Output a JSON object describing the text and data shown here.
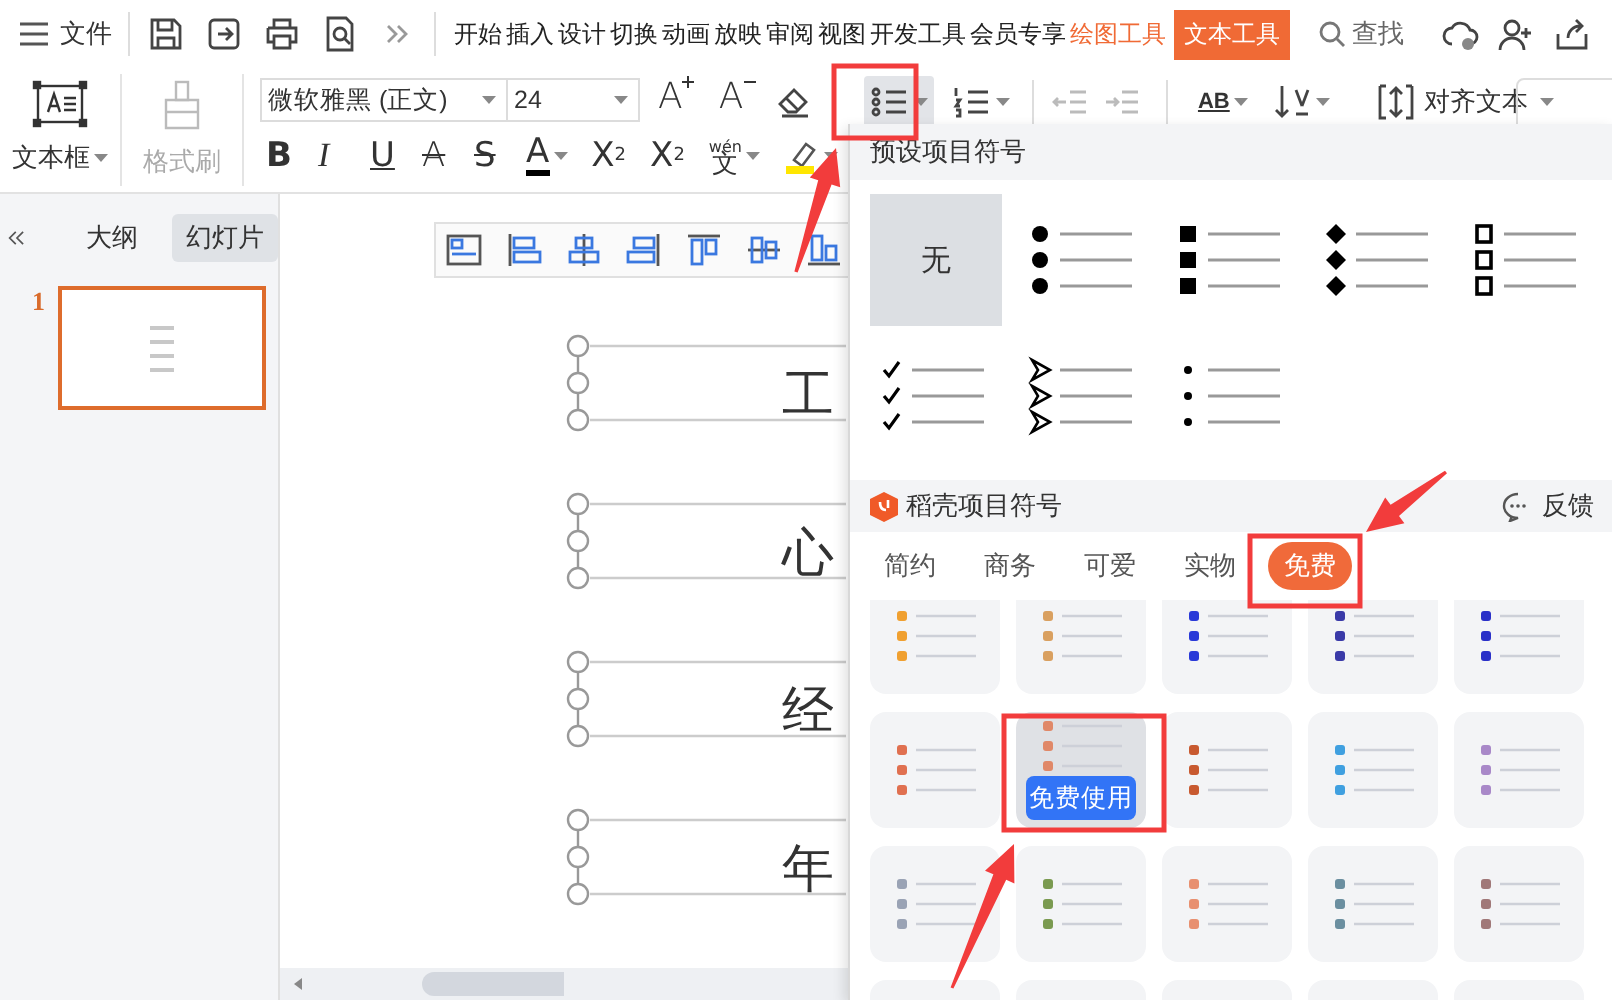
{
  "top_bar": {
    "file_menu": "文件",
    "tabs": [
      {
        "label": "开始",
        "kind": "normal",
        "selected": false
      },
      {
        "label": "插入",
        "kind": "normal",
        "selected": false
      },
      {
        "label": "设计",
        "kind": "normal",
        "selected": false
      },
      {
        "label": "切换",
        "kind": "normal",
        "selected": false
      },
      {
        "label": "动画",
        "kind": "normal",
        "selected": false
      },
      {
        "label": "放映",
        "kind": "normal",
        "selected": false
      },
      {
        "label": "审阅",
        "kind": "normal",
        "selected": false
      },
      {
        "label": "视图",
        "kind": "normal",
        "selected": false
      },
      {
        "label": "开发工具",
        "kind": "normal",
        "selected": false
      },
      {
        "label": "会员专享",
        "kind": "normal",
        "selected": false
      },
      {
        "label": "绘图工具",
        "kind": "context",
        "selected": false
      },
      {
        "label": "文本工具",
        "kind": "context",
        "selected": true
      }
    ],
    "search": "查找"
  },
  "ribbon": {
    "text_box": "文本框",
    "format_painter": {
      "label": "格式刷",
      "disabled": true
    },
    "font_name": "微软雅黑 (正文)",
    "font_size": "24",
    "font_tools": [
      {
        "kind": "grow",
        "label": "A"
      },
      {
        "kind": "shrink",
        "label": "A"
      }
    ],
    "format_buttons": [
      {
        "kind": "bold",
        "label": "B"
      },
      {
        "kind": "italic",
        "label": "I"
      },
      {
        "kind": "underline",
        "label": "U"
      },
      {
        "kind": "strike_a",
        "label": "A"
      },
      {
        "kind": "strike",
        "label": "S"
      },
      {
        "kind": "color",
        "label": "A"
      },
      {
        "kind": "superscript",
        "label": "X",
        "script": "2"
      },
      {
        "kind": "subscript",
        "label": "X",
        "script": "2"
      },
      {
        "kind": "phonetic",
        "label": "文",
        "script": "wén"
      }
    ],
    "bullets": {
      "selected": true
    },
    "text_direction": "AB",
    "align_text": "对齐文本"
  },
  "side_panel": {
    "tabs": [
      {
        "label": "大纲",
        "selected": false
      },
      {
        "label": "幻灯片",
        "selected": true
      }
    ],
    "slides": [
      {
        "number": "1",
        "selected": true
      }
    ]
  },
  "slide": {
    "items": [
      {
        "text": "工"
      },
      {
        "text": "心"
      },
      {
        "text": "经"
      },
      {
        "text": "年"
      }
    ]
  },
  "bullet_menu": {
    "preset_title": "预设项目符号",
    "presets": [
      {
        "kind": "none",
        "label": "无",
        "selected": true
      },
      {
        "kind": "dot",
        "selected": false
      },
      {
        "kind": "square",
        "selected": false
      },
      {
        "kind": "diamond",
        "selected": false
      },
      {
        "kind": "box",
        "selected": false
      },
      {
        "kind": "check",
        "selected": false
      },
      {
        "kind": "arrow",
        "selected": false
      },
      {
        "kind": "small_dot",
        "selected": false
      }
    ],
    "docer_title": "稻壳项目符号",
    "feedback": "反馈",
    "categories": [
      {
        "label": "简约",
        "selected": false
      },
      {
        "label": "商务",
        "selected": false
      },
      {
        "label": "可爱",
        "selected": false
      },
      {
        "label": "实物",
        "selected": false
      },
      {
        "label": "免费",
        "selected": true
      }
    ],
    "cards": [
      {
        "color": "#f0a030",
        "hovered": false
      },
      {
        "color": "#d9a060",
        "hovered": false
      },
      {
        "color": "#2a3ad8",
        "hovered": false
      },
      {
        "color": "#3a3aa8",
        "hovered": false
      },
      {
        "color": "#2a30c8",
        "hovered": false
      },
      {
        "color": "#e07050",
        "hovered": false
      },
      {
        "color": "#e08868",
        "hovered": true,
        "action": "免费使用"
      },
      {
        "color": "#c85a30",
        "hovered": false
      },
      {
        "color": "#40a0e0",
        "hovered": false
      },
      {
        "color": "#a888c8",
        "hovered": false
      },
      {
        "color": "#9aa3b5",
        "hovered": false
      },
      {
        "color": "#7a9a50",
        "hovered": false
      },
      {
        "color": "#e89070",
        "hovered": false
      },
      {
        "color": "#6b8fa0",
        "hovered": false
      },
      {
        "color": "#a07878",
        "hovered": false
      },
      {
        "hovered": false
      },
      {
        "hovered": false
      },
      {
        "hovered": false
      },
      {
        "hovered": false
      },
      {
        "hovered": false
      }
    ]
  }
}
